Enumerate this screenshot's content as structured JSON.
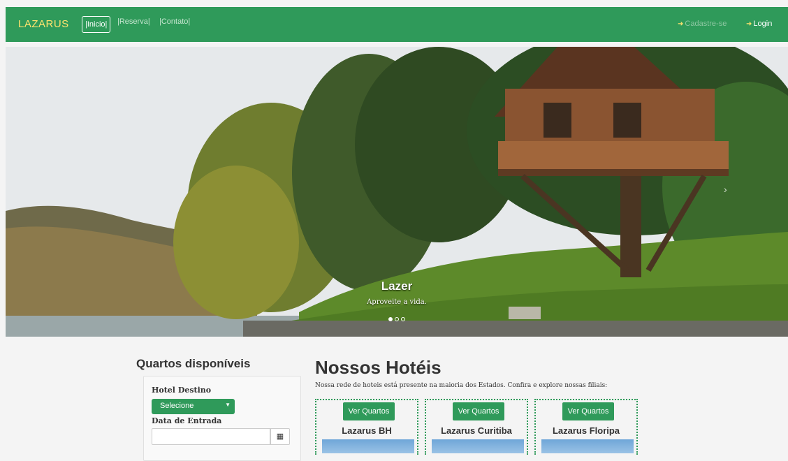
{
  "navbar": {
    "brand": "LAZARUS",
    "links": [
      "|Inicio|",
      "|Reserva|",
      "|Contato|"
    ],
    "signup": "Cadastre-se",
    "login": "Login"
  },
  "carousel": {
    "title": "Lazer",
    "subtitle": "Aproveite a vida.",
    "indicators": 3,
    "active_index": 0
  },
  "search": {
    "title": "Quartos disponíveis",
    "hotel_label": "Hotel Destino",
    "hotel_select": "Selecione",
    "date_label": "Data de Entrada",
    "date_value": ""
  },
  "hotels": {
    "title": "Nossos Hotéis",
    "description": "Nossa rede de hoteis está presente na maioria dos Estados. Confira e explore nossas filiais:",
    "items": [
      {
        "button": "Ver Quartos",
        "name": "Lazarus BH"
      },
      {
        "button": "Ver Quartos",
        "name": "Lazarus Curitiba"
      },
      {
        "button": "Ver Quartos",
        "name": "Lazarus Floripa"
      }
    ]
  },
  "colors": {
    "primary": "#2f9a5a",
    "brand": "#ffe36e"
  }
}
